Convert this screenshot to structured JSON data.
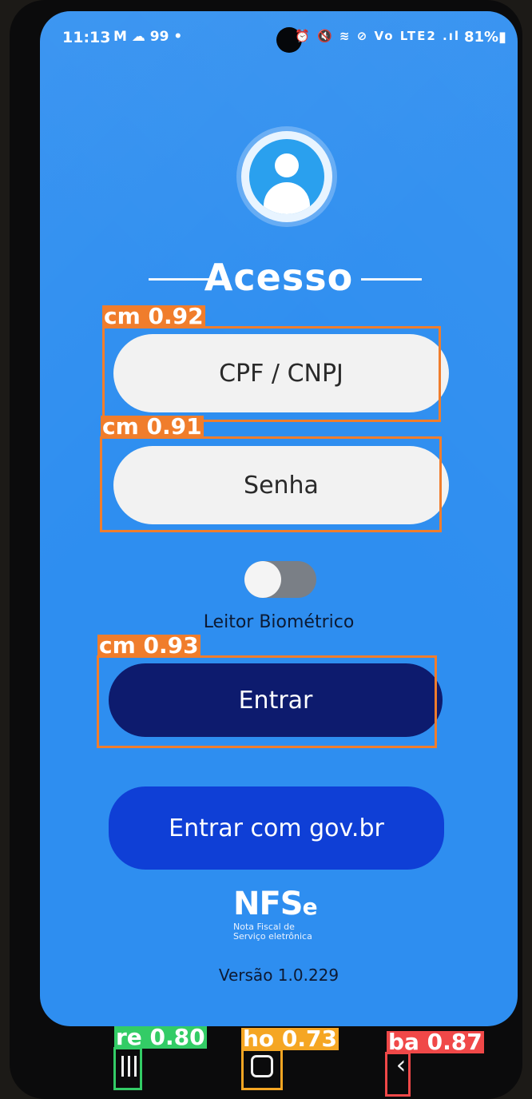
{
  "statusbar": {
    "time": "11:13",
    "left_icons": "M ☁ 99 •",
    "right_icons": "⏰ 🔇 ≋ ⊘ Vo LTE2 .ıl",
    "battery": "81%▮"
  },
  "login": {
    "title": "Acesso",
    "cpf_placeholder": "CPF / CNPJ",
    "senha_placeholder": "Senha",
    "biometric_label": "Leitor Biométrico",
    "biometric_enabled": false,
    "entrar_label": "Entrar",
    "gov_label": "Entrar com gov.br"
  },
  "brand": {
    "logo_main": "NFS",
    "logo_e": "e",
    "subtitle_line1": "Nota Fiscal de",
    "subtitle_line2": "Serviço eletrônica"
  },
  "version": "Versão 1.0.229",
  "detections": [
    {
      "label": "cm 0.92",
      "color": "#f07d2c"
    },
    {
      "label": "cm 0.91",
      "color": "#f07d2c"
    },
    {
      "label": "cm 0.93",
      "color": "#f07d2c"
    },
    {
      "label": "re 0.80",
      "color": "#33cc66"
    },
    {
      "label": "ho 0.73",
      "color": "#f5a623"
    },
    {
      "label": "ba 0.87",
      "color": "#f04848"
    }
  ],
  "colors": {
    "screen_bg": "#2e8ef0",
    "entrar_bg": "#0d1b6e",
    "gov_bg": "#0f3fd6",
    "field_bg": "#f2f2f2"
  }
}
